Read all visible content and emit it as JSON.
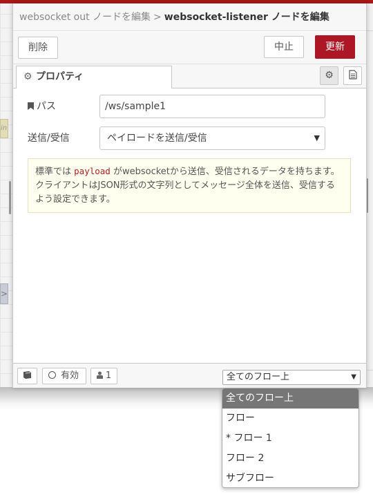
{
  "breadcrumb": {
    "parent": "websocket out ノードを編集",
    "separator": ">",
    "current": "websocket-listener ノードを編集"
  },
  "buttons": {
    "delete": "削除",
    "cancel": "中止",
    "update": "更新"
  },
  "tabs": {
    "properties": "プロパティ",
    "settings_icon": "gear-icon",
    "doc_icon": "document-icon"
  },
  "form": {
    "path_label": "パス",
    "path_value": "/ws/sample1",
    "send_receive_label": "送信/受信",
    "send_receive_value": "ペイロードを送信/受信"
  },
  "tip": {
    "before_code": "標準では ",
    "code": "payload",
    "after_code": " がwebsocketから送信、受信されるデータを持ちます。クライアントはJSON形式の文字列としてメッセージ全体を送信、受信するよう設定できます。"
  },
  "footer": {
    "enabled": "有効",
    "users": "1",
    "scope_value": "全てのフロー上"
  },
  "dropdown": {
    "options": [
      "全てのフロー上",
      "フロー",
      "* フロー 1",
      "フロー 2",
      "サブフロー"
    ],
    "selected_index": 0
  },
  "colors": {
    "primary": "#ad1625",
    "tip_background": "#ffffef"
  }
}
